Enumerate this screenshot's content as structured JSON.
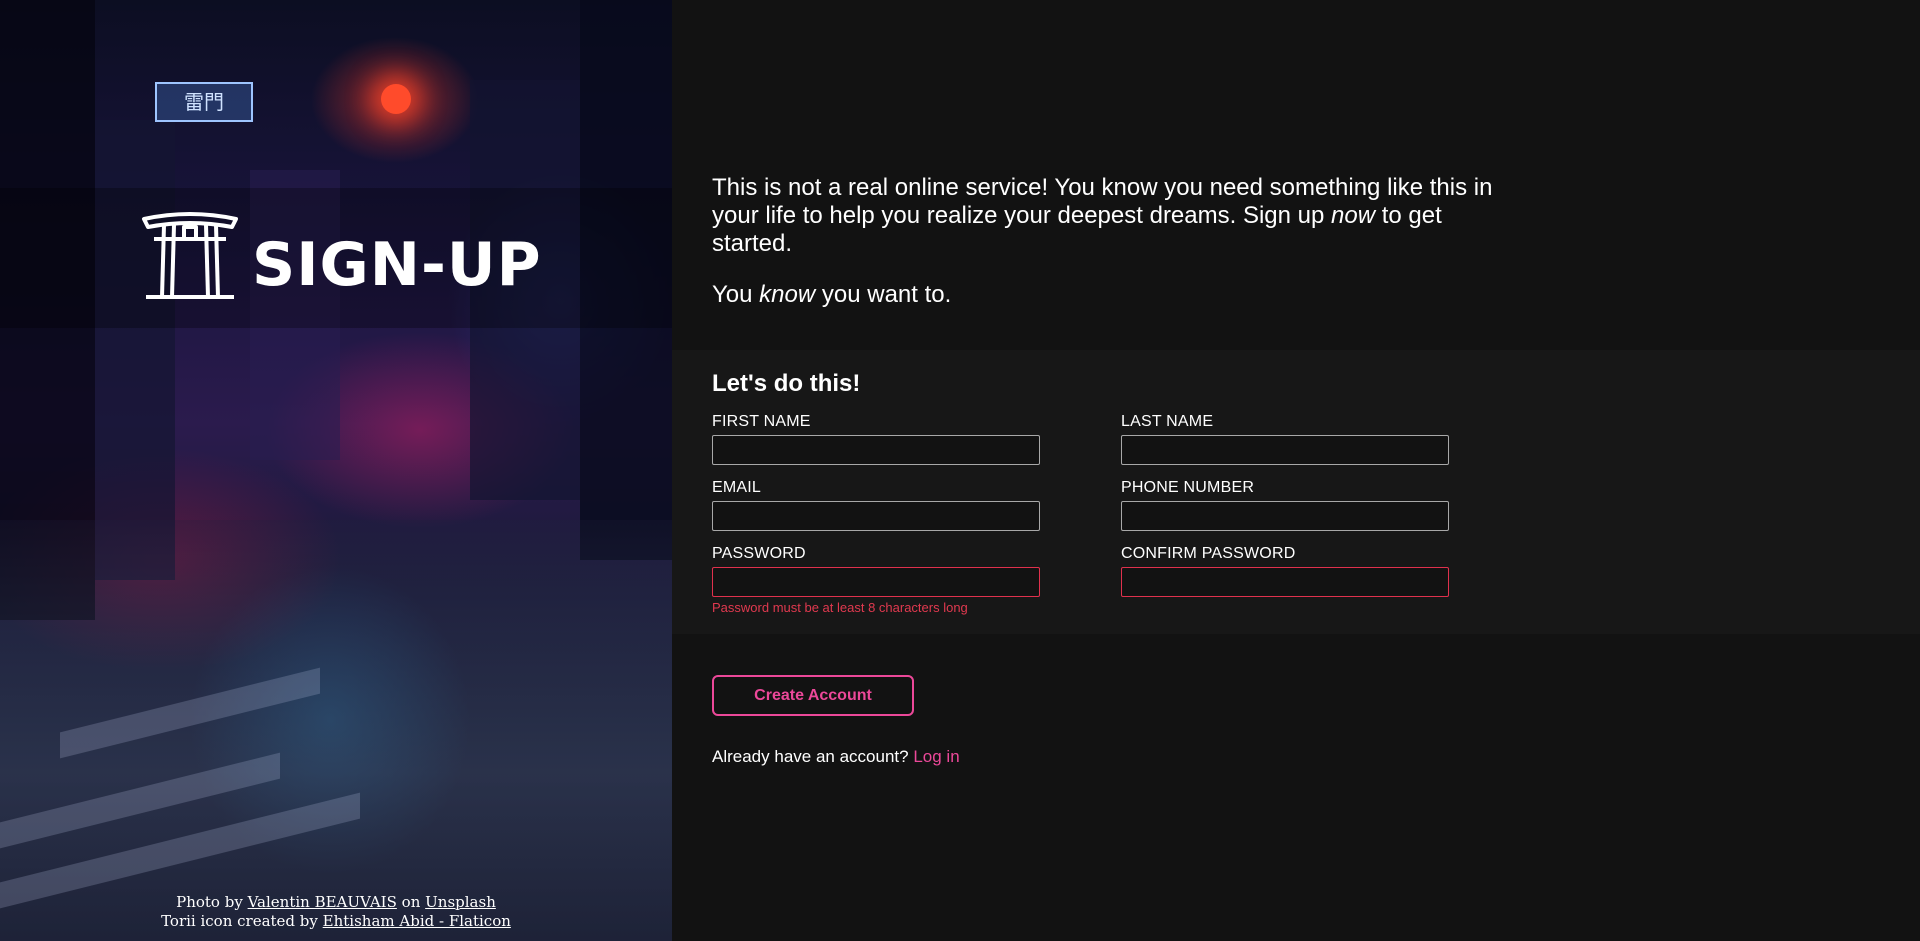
{
  "hero": {
    "logo_text": "SIGN-UP",
    "gate_sign": "雷門",
    "credits": {
      "photo_prefix": "Photo by",
      "photographer": "Valentin BEAUVAIS",
      "on_text": "on",
      "photo_site": "Unsplash",
      "icon_prefix": "Torii icon created by",
      "icon_author": "Ehtisham Abid - Flaticon"
    }
  },
  "intro": {
    "p1_before": "This is not a real online service! You know you need something like this in your life to help you realize your deepest dreams. Sign up ",
    "p1_em": "now",
    "p1_after": " to get started.",
    "p2_before": "You ",
    "p2_em": "know",
    "p2_after": " you want to."
  },
  "form": {
    "title": "Let's do this!",
    "first_name": {
      "label": "FIRST NAME",
      "value": ""
    },
    "last_name": {
      "label": "LAST NAME",
      "value": ""
    },
    "email": {
      "label": "EMAIL",
      "value": ""
    },
    "phone": {
      "label": "PHONE NUMBER",
      "value": ""
    },
    "password": {
      "label": "PASSWORD",
      "value": ""
    },
    "confirm_password": {
      "label": "CONFIRM PASSWORD",
      "value": ""
    },
    "password_error": "Password must be at least 8 characters long",
    "submit_label": "Create Account",
    "login_prompt": "Already have an account?",
    "login_link": "Log in"
  },
  "colors": {
    "accent": "#ec4899",
    "error": "#e0314d",
    "background": "#121212",
    "form_band": "#171717"
  }
}
